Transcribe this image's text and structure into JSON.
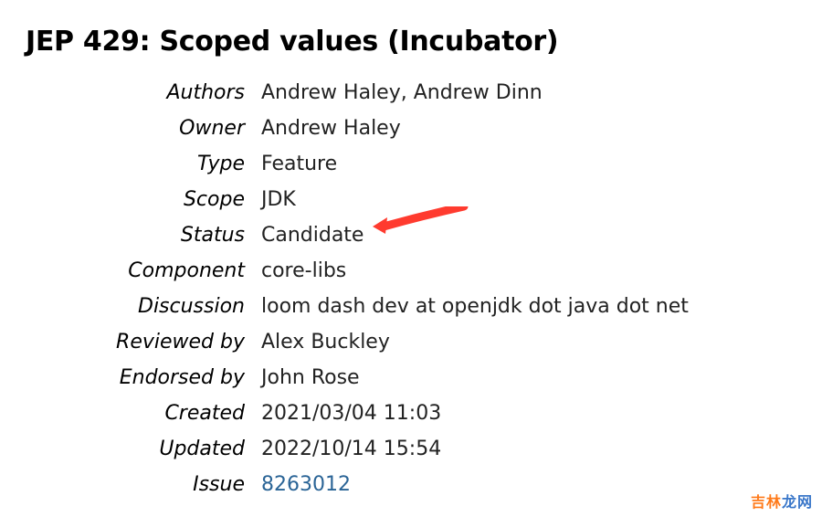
{
  "title": "JEP 429: Scoped values (Incubator)",
  "rows": {
    "authors": {
      "label": "Authors",
      "value": "Andrew Haley, Andrew Dinn"
    },
    "owner": {
      "label": "Owner",
      "value": "Andrew Haley"
    },
    "type": {
      "label": "Type",
      "value": "Feature"
    },
    "scope": {
      "label": "Scope",
      "value": "JDK"
    },
    "status": {
      "label": "Status",
      "value": "Candidate"
    },
    "component": {
      "label": "Component",
      "value": "core-libs"
    },
    "discussion": {
      "label": "Discussion",
      "value": "loom dash dev at openjdk dot java dot net"
    },
    "reviewed_by": {
      "label": "Reviewed by",
      "value": "Alex Buckley"
    },
    "endorsed_by": {
      "label": "Endorsed by",
      "value": "John Rose"
    },
    "created": {
      "label": "Created",
      "value": "2021/03/04 11:03"
    },
    "updated": {
      "label": "Updated",
      "value": "2022/10/14 15:54"
    },
    "issue": {
      "label": "Issue",
      "value": "8263012"
    }
  },
  "watermark": {
    "part1": "吉林",
    "part2": "龙网"
  },
  "arrow_color": "#ff3b2f"
}
